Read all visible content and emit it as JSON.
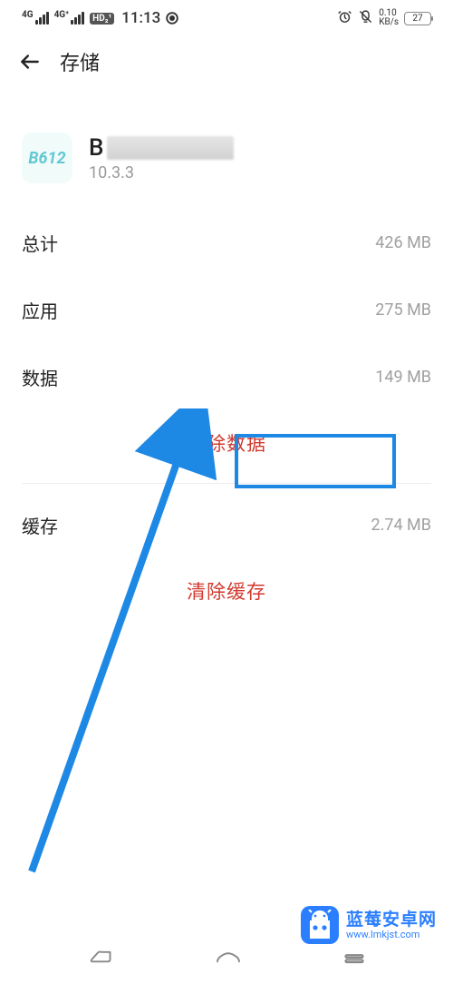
{
  "status_bar": {
    "signal1_label": "4G",
    "signal2_label": "4G⁺",
    "hd_badge": "HD₂¹",
    "time": "11:13",
    "speed_top": "0.10",
    "speed_bottom": "KB/s",
    "battery": "27"
  },
  "header": {
    "title": "存储"
  },
  "app": {
    "icon_text": "B612",
    "name_prefix": "B",
    "version": "10.3.3"
  },
  "rows": {
    "total_label": "总计",
    "total_value": "426 MB",
    "app_label": "应用",
    "app_value": "275 MB",
    "data_label": "数据",
    "data_value": "149 MB",
    "clear_data": "清除数据",
    "cache_label": "缓存",
    "cache_value": "2.74 MB",
    "clear_cache": "清除缓存"
  },
  "watermark": {
    "cn": "蓝莓安卓网",
    "url": "www.lmkjst.com"
  }
}
